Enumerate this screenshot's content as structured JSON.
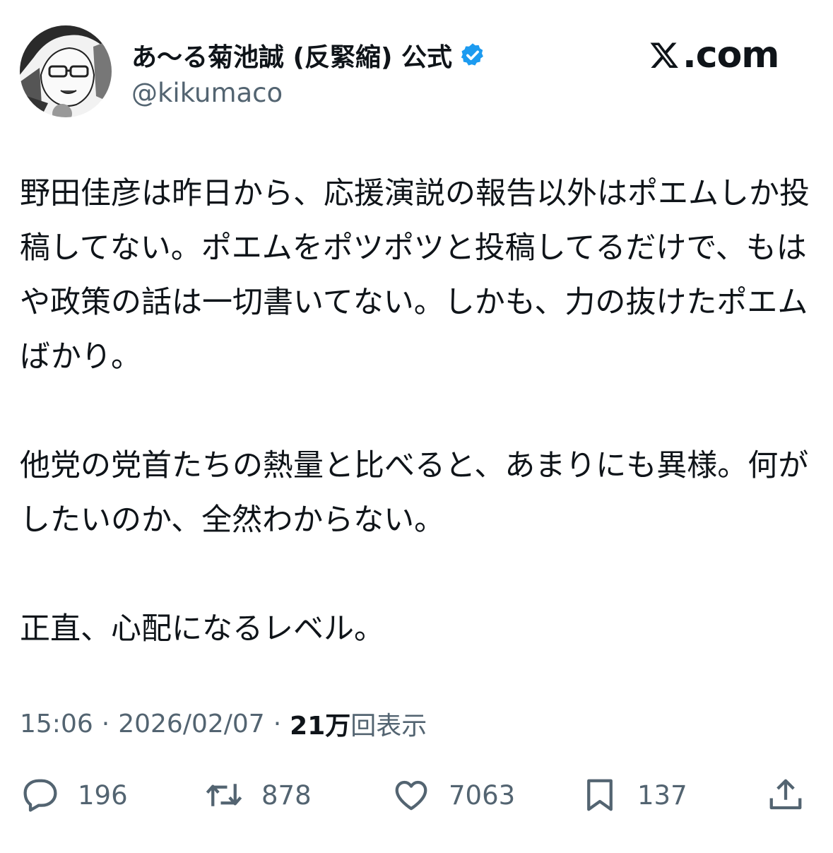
{
  "author": {
    "name": "あ〜る菊池誠 (反緊縮) 公式",
    "handle": "@kikumaco",
    "verified": true,
    "verified_color": "#1d9bf0"
  },
  "brand": {
    "icon": "x-logo-icon",
    "label": ".com"
  },
  "tweet": {
    "text": "野田佳彦は昨日から、応援演説の報告以外はポエムしか投稿してない。ポエムをポツポツと投稿してるだけで、もはや政策の話は一切書いてない。しかも、力の抜けたポエムばかり。\n\n他党の党首たちの熱量と比べると、あまりにも異様。何がしたいのか、全然わからない。\n\n正直、心配になるレベル。"
  },
  "meta": {
    "time": "15:06",
    "date": "2026/02/07",
    "separator": "·",
    "views_count": "21万",
    "views_label": "回表示"
  },
  "actions": {
    "reply": {
      "icon": "reply-icon",
      "count": "196"
    },
    "repost": {
      "icon": "repost-icon",
      "count": "878"
    },
    "like": {
      "icon": "heart-icon",
      "count": "7063"
    },
    "bookmark": {
      "icon": "bookmark-icon",
      "count": "137"
    },
    "share": {
      "icon": "share-icon"
    }
  },
  "colors": {
    "text": "#0f1419",
    "secondary": "#536471"
  }
}
